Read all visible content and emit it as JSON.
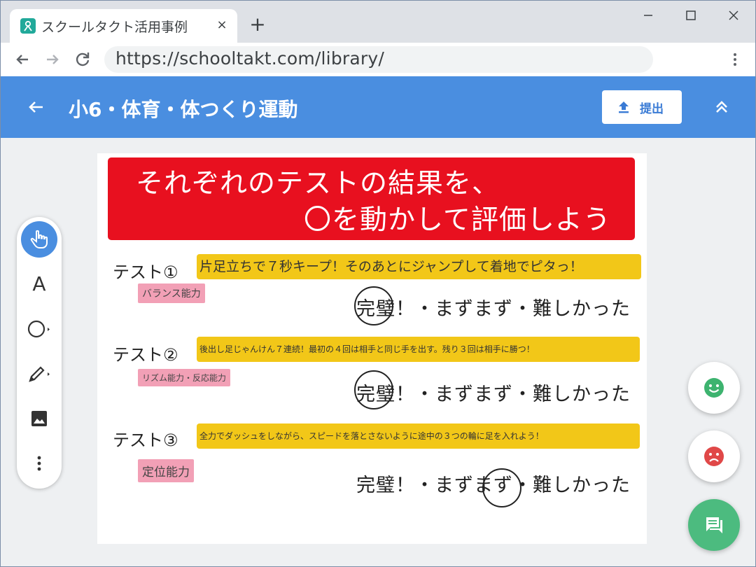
{
  "browser": {
    "tab_title": "スクールタクト活用事例",
    "tab_close": "×",
    "new_tab": "+",
    "url": "https://schooltakt.com/library/",
    "favicon_color": "#21a99a"
  },
  "header": {
    "title": "小6・体育・体つくり運動",
    "submit_label": "提出",
    "color": "#4a8ee0"
  },
  "worksheet": {
    "banner_line1": "それぞれのテストの結果を、",
    "banner_line2": "〇を動かして評価しよう",
    "banner_color": "#e8101f",
    "rating_options": "完璧！・まずまず・難しかった",
    "tests": [
      {
        "label": "テスト①",
        "description": "片足立ちで７秒キープ！そのあとにジャンプして着地でピタっ！",
        "ability": "バランス能力",
        "selected": "完璧！"
      },
      {
        "label": "テスト②",
        "description": "後出し足じゃんけん７連続！最初の４回は相手と同じ手を出す。残り３回は相手に勝つ！",
        "ability": "リズム能力・反応能力",
        "selected": "完璧！"
      },
      {
        "label": "テスト③",
        "description": "全力でダッシュをしながら、スピードを落とさないように途中の３つの輪に足を入れよう！",
        "ability": "定位能力",
        "selected": "まずまず"
      }
    ]
  },
  "toolbar": {
    "text_tool": "A",
    "tools": [
      "pointer-icon",
      "text-icon",
      "shape-icon",
      "pen-icon",
      "image-icon",
      "more-icon"
    ],
    "active_tool": "pointer-icon"
  },
  "reactions": {
    "icons": [
      "smile-icon",
      "frown-icon",
      "chat-icon"
    ],
    "smile_color": "#3db36f",
    "frown_color": "#e04848",
    "chat_color": "#4cbb7f"
  }
}
